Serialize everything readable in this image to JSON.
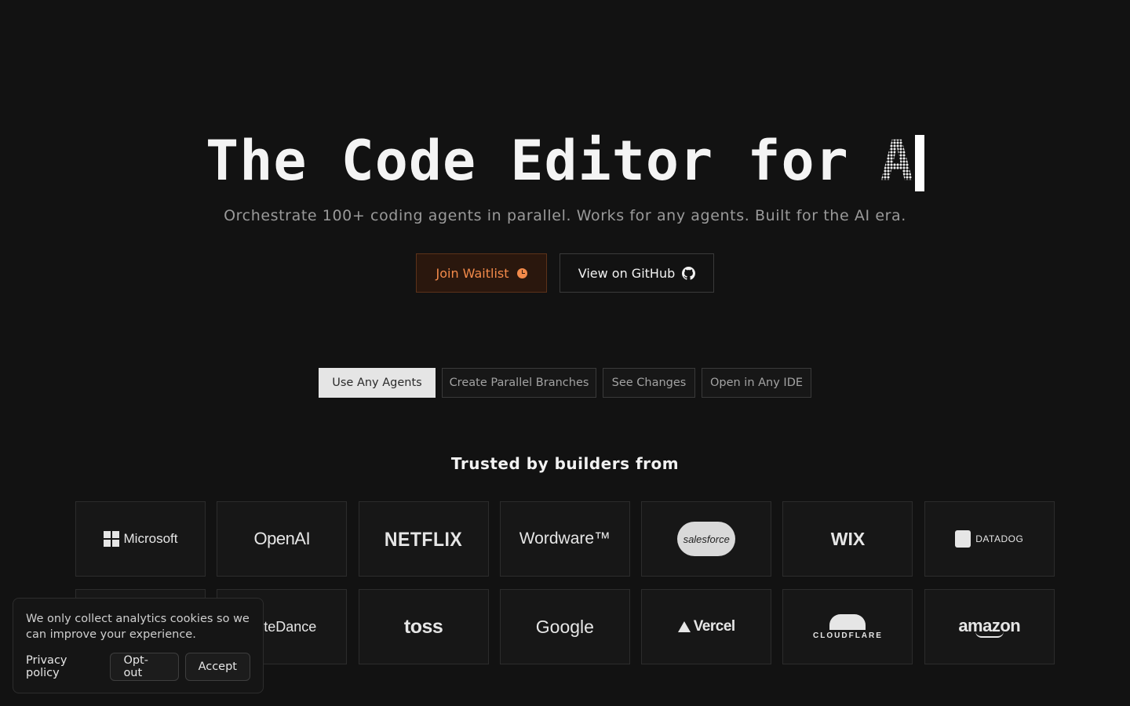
{
  "hero": {
    "title": "The Code Editor for",
    "title_accent": "A",
    "subtitle": "Orchestrate 100+ coding agents in parallel. Works for any agents. Built for the AI era."
  },
  "cta": {
    "waitlist_label": "Join Waitlist",
    "waitlist_icon": "clock-icon",
    "github_label": "View on GitHub",
    "github_icon": "github-icon"
  },
  "tabs": [
    {
      "label": "Use Any Agents",
      "active": true
    },
    {
      "label": "Create Parallel Branches",
      "active": false
    },
    {
      "label": "See Changes",
      "active": false
    },
    {
      "label": "Open in Any IDE",
      "active": false
    }
  ],
  "trusted": {
    "heading": "Trusted by builders from",
    "logos": [
      "Microsoft",
      "OpenAI",
      "NETFLIX",
      "Wordware™",
      "salesforce",
      "WIX",
      "DATADOG",
      "",
      "ByteDance",
      "toss",
      "Google",
      "Vercel",
      "CLOUDFLARE",
      "amazon"
    ]
  },
  "cookie": {
    "message": "We only collect analytics cookies so we can improve your experience.",
    "privacy_label": "Privacy policy",
    "optout_label": "Opt-out",
    "accept_label": "Accept"
  },
  "colors": {
    "background": "#121212",
    "accent": "#f38a4a",
    "accent_bg": "#2a170d"
  }
}
